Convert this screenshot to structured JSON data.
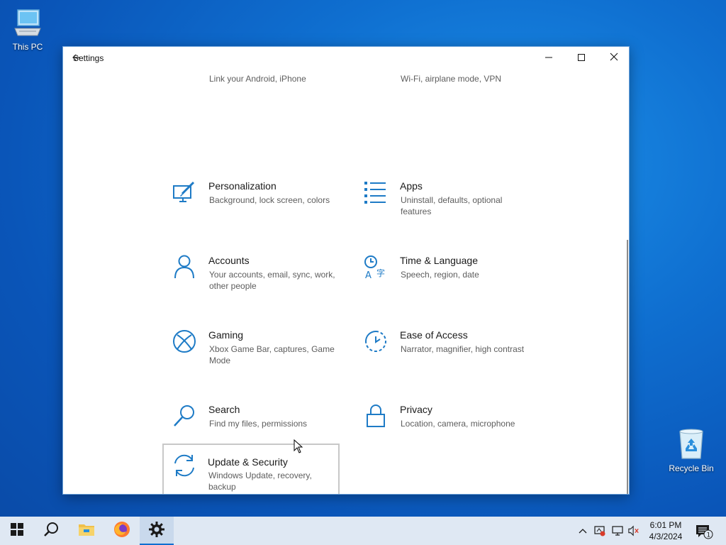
{
  "desktop": {
    "icons": [
      {
        "label": "This PC",
        "icon": "computer-icon"
      },
      {
        "label": "Recycle Bin",
        "icon": "recycle-bin-icon"
      }
    ]
  },
  "window": {
    "title": "Settings",
    "back_icon": "back-arrow-icon",
    "controls": [
      "minimize-icon",
      "maximize-icon",
      "close-icon"
    ]
  },
  "tiles": [
    {
      "title": "",
      "desc": "Link your Android, iPhone",
      "icon": "phone-icon"
    },
    {
      "title": "",
      "desc": "Wi-Fi, airplane mode, VPN",
      "icon": "globe-icon"
    },
    {
      "title": "Personalization",
      "desc": "Background, lock screen, colors",
      "icon": "personalization-icon"
    },
    {
      "title": "Apps",
      "desc": "Uninstall, defaults, optional features",
      "icon": "apps-icon"
    },
    {
      "title": "Accounts",
      "desc": "Your accounts, email, sync, work, other people",
      "icon": "person-icon"
    },
    {
      "title": "Time & Language",
      "desc": "Speech, region, date",
      "icon": "time-language-icon"
    },
    {
      "title": "Gaming",
      "desc": "Xbox Game Bar, captures, Game Mode",
      "icon": "xbox-icon"
    },
    {
      "title": "Ease of Access",
      "desc": "Narrator, magnifier, high contrast",
      "icon": "ease-of-access-icon"
    },
    {
      "title": "Search",
      "desc": "Find my files, permissions",
      "icon": "search-icon"
    },
    {
      "title": "Privacy",
      "desc": "Location, camera, microphone",
      "icon": "lock-icon"
    },
    {
      "title": "Update & Security",
      "desc": "Windows Update, recovery, backup",
      "icon": "sync-icon"
    }
  ],
  "taskbar": {
    "apps": [
      "windows-start-icon",
      "search-icon",
      "file-explorer-icon",
      "firefox-icon",
      "settings-gear-icon"
    ],
    "tray": [
      "chevron-up-icon",
      "network-warning-icon",
      "display-icon",
      "volume-muted-icon"
    ],
    "time": "6:01 PM",
    "date": "4/3/2024",
    "notification_count": "1"
  },
  "colors": {
    "accent": "#0f6fd0",
    "icon_blue": "#1e7bc6",
    "taskbar_bg": "#dfe8f3"
  }
}
